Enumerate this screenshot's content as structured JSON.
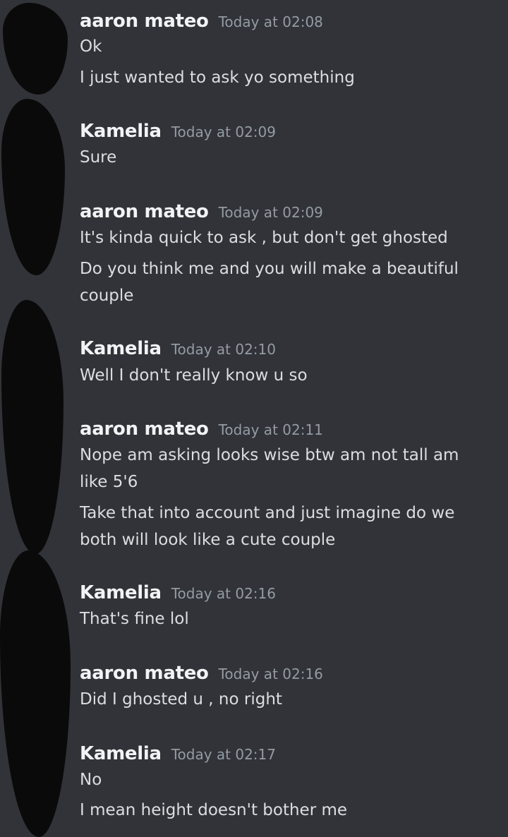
{
  "messages": [
    {
      "author": "aaron mateo",
      "time": "Today at 02:08",
      "lines": [
        "Ok",
        "I just wanted to ask yo something"
      ]
    },
    {
      "author": "Kamelia",
      "time": "Today at 02:09",
      "lines": [
        "Sure"
      ]
    },
    {
      "author": "aaron mateo",
      "time": "Today at 02:09",
      "lines": [
        "It's kinda quick to ask , but don't get ghosted",
        "Do you think me and you will make a beautiful couple"
      ]
    },
    {
      "author": "Kamelia",
      "time": "Today at 02:10",
      "lines": [
        "Well I don't really know u so"
      ]
    },
    {
      "author": "aaron mateo",
      "time": "Today at 02:11",
      "lines": [
        "Nope am asking looks wise btw am not tall am like 5'6",
        "Take that into account and just imagine do we both will look like a cute couple"
      ]
    },
    {
      "author": "Kamelia",
      "time": "Today at 02:16",
      "lines": [
        "That's fine lol"
      ]
    },
    {
      "author": "aaron mateo",
      "time": "Today at 02:16",
      "lines": [
        "Did I ghosted u , no right"
      ]
    },
    {
      "author": "Kamelia",
      "time": "Today at 02:17",
      "lines": [
        "No",
        "I mean height doesn't bother me"
      ]
    }
  ]
}
